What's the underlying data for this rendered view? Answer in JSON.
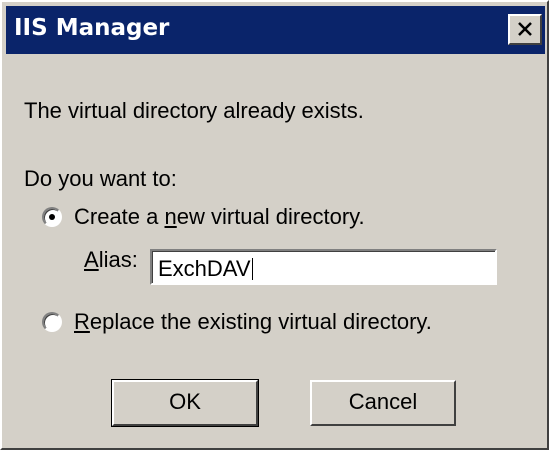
{
  "dialog": {
    "title": "IIS Manager",
    "message": "The virtual directory already exists.",
    "question": "Do you want to:",
    "options": [
      {
        "pre": "Create a ",
        "key": "n",
        "post": "ew virtual directory.",
        "selected": true
      },
      {
        "pre": "",
        "key": "R",
        "post": "eplace the existing virtual directory.",
        "selected": false
      }
    ],
    "alias": {
      "key": "A",
      "rest": "lias:",
      "value": "ExchDAV"
    },
    "buttons": {
      "ok": "OK",
      "cancel": "Cancel"
    }
  }
}
